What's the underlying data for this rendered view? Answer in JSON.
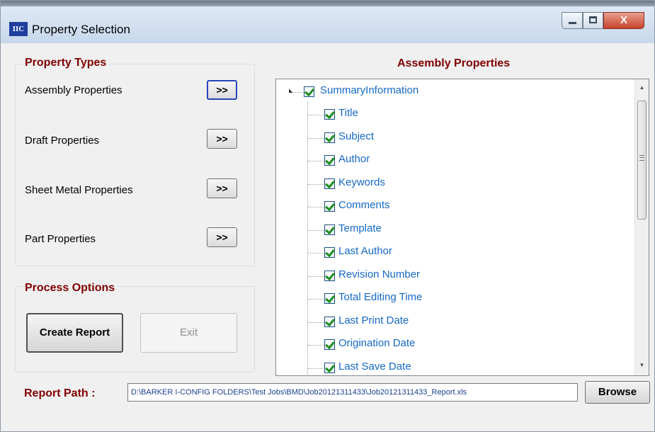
{
  "window": {
    "icon_text": "IIC",
    "title": "Property Selection",
    "controls": {
      "minimize_icon": "minimize-icon",
      "maximize_icon": "maximize-icon",
      "close_label": "X"
    }
  },
  "property_types": {
    "heading": "Property Types",
    "items": [
      {
        "label": "Assembly Properties",
        "button": ">>",
        "focused": true
      },
      {
        "label": "Draft Properties",
        "button": ">>"
      },
      {
        "label": "Sheet Metal Properties",
        "button": ">>"
      },
      {
        "label": "Part Properties",
        "button": ">>"
      }
    ]
  },
  "process_options": {
    "heading": "Process Options",
    "create_report": "Create Report",
    "exit": "Exit"
  },
  "assembly_panel": {
    "heading": "Assembly Properties",
    "root": {
      "label": "SummaryInformation",
      "checked": true,
      "expanded": true
    },
    "children": [
      {
        "label": "Title",
        "checked": true
      },
      {
        "label": "Subject",
        "checked": true
      },
      {
        "label": "Author",
        "checked": true
      },
      {
        "label": "Keywords",
        "checked": true
      },
      {
        "label": "Comments",
        "checked": true
      },
      {
        "label": "Template",
        "checked": true
      },
      {
        "label": "Last Author",
        "checked": true
      },
      {
        "label": "Revision Number",
        "checked": true
      },
      {
        "label": "Total Editing Time",
        "checked": true
      },
      {
        "label": "Last Print Date",
        "checked": true
      },
      {
        "label": "Origination Date",
        "checked": true
      },
      {
        "label": "Last Save Date",
        "checked": true
      }
    ]
  },
  "report_path": {
    "label": "Report Path :",
    "value": "D:\\BARKER I-CONFIG FOLDERS\\Test Jobs\\BMD\\Job20121311433\\Job20121311433_Report.xls",
    "browse": "Browse"
  },
  "colors": {
    "heading": "#800000",
    "tree_text": "#1569c7",
    "check": "#1e8f1e",
    "focus_border": "#2a44b8"
  }
}
